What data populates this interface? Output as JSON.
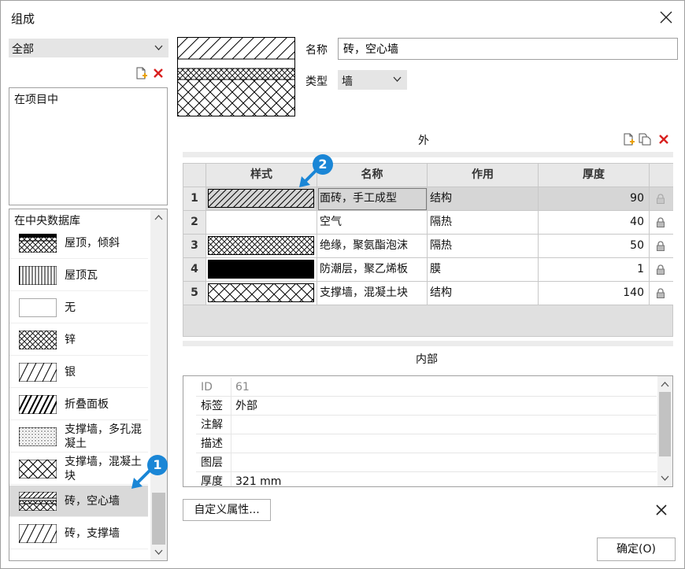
{
  "window": {
    "title": "组成"
  },
  "left": {
    "filter": {
      "value": "全部"
    },
    "project_list": {
      "items": [
        "在项目中"
      ]
    },
    "library": {
      "header": "在中央数据库",
      "items": [
        {
          "label": "屋顶，倾斜",
          "pattern": "diamond-band"
        },
        {
          "label": "屋顶瓦",
          "pattern": "vertical"
        },
        {
          "label": "无",
          "pattern": "none"
        },
        {
          "label": "锌",
          "pattern": "cross"
        },
        {
          "label": "银",
          "pattern": "diagonal"
        },
        {
          "label": "折叠面板",
          "pattern": "diagonal-dense"
        },
        {
          "label": "支撑墙，多孔混凝土",
          "pattern": "dots"
        },
        {
          "label": "支撑墙，混凝土块",
          "pattern": "cross-large"
        },
        {
          "label": "砖，空心墙",
          "pattern": "composite",
          "selected": true
        },
        {
          "label": "砖，支撑墙",
          "pattern": "diagonal"
        }
      ]
    }
  },
  "details": {
    "name_label": "名称",
    "name_value": "砖，空心墙",
    "type_label": "类型",
    "type_value": "墙"
  },
  "outer": {
    "label": "外",
    "columns": [
      "样式",
      "名称",
      "作用",
      "厚度"
    ],
    "rows": [
      {
        "no": "1",
        "pattern": "diagonal",
        "name": "面砖，手工成型",
        "role": "结构",
        "thickness": "90"
      },
      {
        "no": "2",
        "pattern": "none",
        "name": "空气",
        "role": "隔热",
        "thickness": "40"
      },
      {
        "no": "3",
        "pattern": "cross",
        "name": "绝缘，聚氨酯泡沫",
        "role": "隔热",
        "thickness": "50"
      },
      {
        "no": "4",
        "pattern": "solid",
        "name": "防潮层，聚乙烯板",
        "role": "膜",
        "thickness": "1"
      },
      {
        "no": "5",
        "pattern": "cross-large",
        "name": "支撑墙，混凝土块",
        "role": "结构",
        "thickness": "140"
      }
    ]
  },
  "inner": {
    "label": "内部"
  },
  "properties": [
    {
      "key": "ID",
      "value": "61"
    },
    {
      "key": "标签",
      "value": "外部"
    },
    {
      "key": "注解",
      "value": ""
    },
    {
      "key": "描述",
      "value": ""
    },
    {
      "key": "图层",
      "value": ""
    },
    {
      "key": "厚度",
      "value": "321 mm"
    }
  ],
  "buttons": {
    "custom": "自定义属性...",
    "ok": "确定(O)"
  },
  "badges": [
    "1",
    "2"
  ],
  "colors": {
    "accent": "#1a86d6",
    "delete": "#d9201f",
    "selection": "#d9d9d9"
  },
  "icons": {
    "add": "add-document-icon",
    "copy": "copy-icon",
    "delete": "delete-icon",
    "lock": "lock-icon",
    "close": "close-icon"
  }
}
